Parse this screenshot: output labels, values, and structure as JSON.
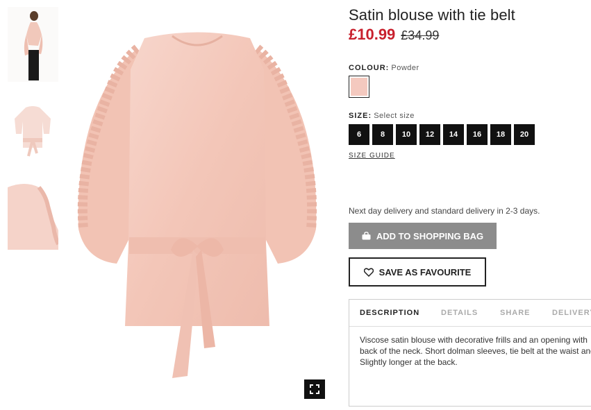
{
  "product": {
    "title": "Satin blouse with tie belt",
    "price_sale": "£10.99",
    "price_original": "£34.99"
  },
  "colour": {
    "label": "COLOUR:",
    "value": "Powder",
    "swatch_color": "#f4c9bf"
  },
  "size": {
    "label": "SIZE:",
    "value": "Select size",
    "options": [
      "6",
      "8",
      "10",
      "12",
      "14",
      "16",
      "18",
      "20"
    ],
    "guide_label": "SIZE GUIDE"
  },
  "delivery_text": "Next day delivery and standard delivery in 2-3 days.",
  "buttons": {
    "add_to_bag": "ADD TO SHOPPING BAG",
    "save_favourite": "SAVE AS FAVOURITE"
  },
  "tabs": [
    "DESCRIPTION",
    "DETAILS",
    "SHARE",
    "DELIVERY"
  ],
  "description": {
    "line1": "Viscose satin blouse with decorative frills and an opening with",
    "line2": "back of the neck. Short dolman sleeves, tie belt at the waist and",
    "line3": "Slightly longer at the back."
  },
  "colors": {
    "sale_price": "#c8202d",
    "button_disabled": "#8c8c8c",
    "size_chip": "#111111"
  },
  "icons": [
    "bag-icon",
    "heart-icon",
    "expand-icon"
  ]
}
